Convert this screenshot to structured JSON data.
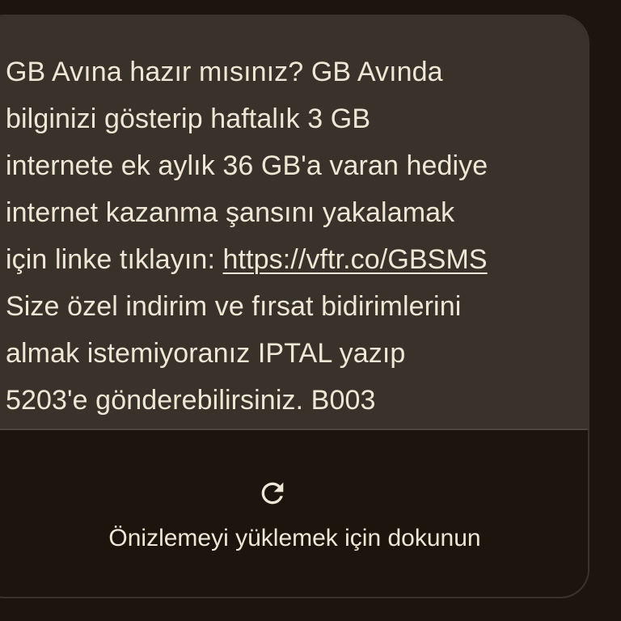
{
  "message": {
    "text_before_link": "GB Avına hazır mısınız? GB Avında\nbilginizi gösterip haftalık 3 GB\ninternete ek aylık 36 GB'a varan hediye\ninternet kazanma şansını yakalamak\niçin linke tıklayın: ",
    "link_text": "https://vftr.co/GBSMS",
    "text_after_link": "\nSize özel indirim ve fırsat bidirimlerini\nalmak istemiyoranız IPTAL yazıp\n5203'e gönderebilirsiniz. B003"
  },
  "preview": {
    "icon": "refresh-icon",
    "label": "Önizlemeyi yüklemek için dokunun"
  },
  "colors": {
    "background": "#1c150e",
    "bubble": "#38322a",
    "text": "#efe6d6"
  }
}
